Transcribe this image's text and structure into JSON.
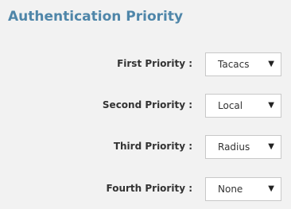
{
  "title": "Authentication Priority",
  "priorities": [
    {
      "label": "First Priority :",
      "value": "Tacacs"
    },
    {
      "label": "Second Priority :",
      "value": "Local"
    },
    {
      "label": "Third Priority :",
      "value": "Radius"
    },
    {
      "label": "Fourth Priority :",
      "value": "None"
    }
  ],
  "icons": {
    "dropdown": "chevron-down-icon"
  },
  "colors": {
    "title": "#4f86a9",
    "background": "#f2f2f2",
    "select_border": "#c8c8c8"
  }
}
